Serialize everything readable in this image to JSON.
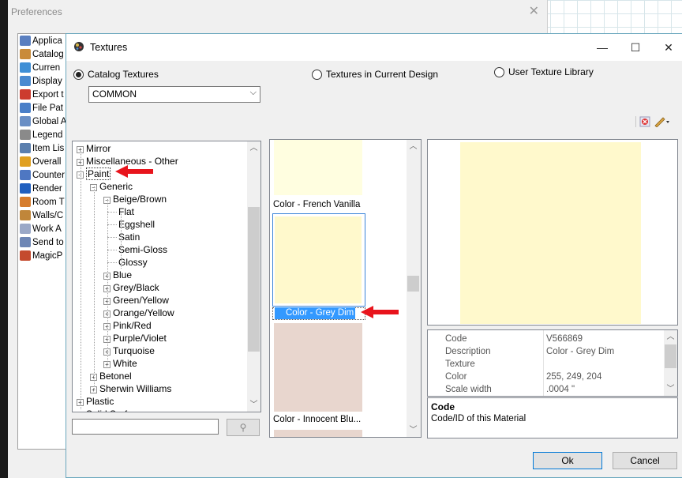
{
  "preferences": {
    "title": "Preferences",
    "close_glyph": "✕",
    "items": [
      {
        "label": "Applica",
        "color": "#5a7fc0"
      },
      {
        "label": "Catalog",
        "color": "#c98b3a"
      },
      {
        "label": "Curren",
        "color": "#3f8fd6"
      },
      {
        "label": "Display",
        "color": "#4a8ad0"
      },
      {
        "label": "Export t",
        "color": "#cc3b2e"
      },
      {
        "label": "File Pat",
        "color": "#4a7fc8"
      },
      {
        "label": "Global A",
        "color": "#6a8fc5"
      },
      {
        "label": "Legend",
        "color": "#8a8a8a"
      },
      {
        "label": "Item Lis",
        "color": "#5b7fae"
      },
      {
        "label": "Overall",
        "color": "#e0a020"
      },
      {
        "label": "Counter",
        "color": "#4e77c2"
      },
      {
        "label": "Render",
        "color": "#1f5fbf"
      },
      {
        "label": "Room T",
        "color": "#d67d2e"
      },
      {
        "label": "Walls/C",
        "color": "#c0863a"
      },
      {
        "label": "Work A",
        "color": "#9aa8c7"
      },
      {
        "label": "Send to",
        "color": "#6d86b5"
      },
      {
        "label": "MagicP",
        "color": "#c44a2e"
      }
    ]
  },
  "dialog": {
    "title": "Textures",
    "minimize_glyph": "—",
    "maximize_glyph": "☐",
    "close_glyph": "✕",
    "source_options": {
      "catalog": "Catalog Textures",
      "current": "Textures in Current Design",
      "user": "User Texture Library",
      "selected": "catalog"
    },
    "catalog_select": {
      "value": "COMMON"
    },
    "tree": {
      "rows": [
        {
          "label": "Mirror",
          "toggle": "+",
          "level": 0
        },
        {
          "label": "Miscellaneous - Other",
          "toggle": "+",
          "level": 0
        },
        {
          "label": "Paint",
          "toggle": "−",
          "level": 0,
          "selected": true
        },
        {
          "label": "Generic",
          "toggle": "−",
          "level": 1
        },
        {
          "label": "Beige/Brown",
          "toggle": "−",
          "level": 2
        },
        {
          "label": "Flat",
          "toggle": "",
          "level": 3
        },
        {
          "label": "Eggshell",
          "toggle": "",
          "level": 3
        },
        {
          "label": "Satin",
          "toggle": "",
          "level": 3
        },
        {
          "label": "Semi-Gloss",
          "toggle": "",
          "level": 3
        },
        {
          "label": "Glossy",
          "toggle": "",
          "level": 3
        },
        {
          "label": "Blue",
          "toggle": "+",
          "level": 2
        },
        {
          "label": "Grey/Black",
          "toggle": "+",
          "level": 2
        },
        {
          "label": "Green/Yellow",
          "toggle": "+",
          "level": 2
        },
        {
          "label": "Orange/Yellow",
          "toggle": "+",
          "level": 2
        },
        {
          "label": "Pink/Red",
          "toggle": "+",
          "level": 2
        },
        {
          "label": "Purple/Violet",
          "toggle": "+",
          "level": 2
        },
        {
          "label": "Turquoise",
          "toggle": "+",
          "level": 2
        },
        {
          "label": "White",
          "toggle": "+",
          "level": 2
        },
        {
          "label": "Betonel",
          "toggle": "+",
          "level": 1
        },
        {
          "label": "Sherwin Williams",
          "toggle": "+",
          "level": 1
        },
        {
          "label": "Plastic",
          "toggle": "+",
          "level": 0
        },
        {
          "label": "Solid Surface",
          "toggle": "+",
          "level": 0
        }
      ]
    },
    "search": {
      "placeholder": "",
      "button_glyph": "⚲"
    },
    "swatches": [
      {
        "label": "Color - French Vanilla",
        "color": "#fffee0",
        "selected": false
      },
      {
        "label": "Color - Grey Dim",
        "color": "#fff9cc",
        "selected": true
      },
      {
        "label": "Color - Innocent Blu...",
        "color": "#e8d6ce",
        "selected": false
      }
    ],
    "preview": {
      "color": "#fff9cc"
    },
    "properties": [
      {
        "key": "Code",
        "value": "V566869"
      },
      {
        "key": "Description",
        "value": "Color - Grey Dim"
      },
      {
        "key": "Texture",
        "value": ""
      },
      {
        "key": "Color",
        "value": "255, 249, 204"
      },
      {
        "key": "Scale width",
        "value": ".0004 \""
      }
    ],
    "help": {
      "title": "Code",
      "text": "Code/ID of this Material"
    },
    "ok_label": "Ok",
    "cancel_label": "Cancel"
  },
  "accent_color": "#0078d7",
  "annotation_arrow_color": "#e8141c"
}
